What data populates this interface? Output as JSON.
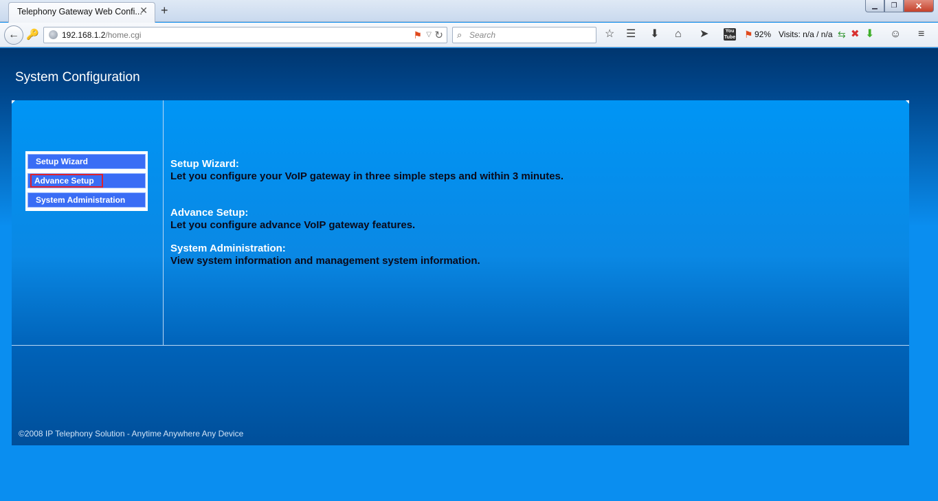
{
  "browser": {
    "tab_title": "Telephony Gateway Web Confi...",
    "tab_close": "✕",
    "new_tab": "+",
    "url_host": "192.168.1.2",
    "url_path": "/home.cgi",
    "search_placeholder": "Search",
    "battery": "92%",
    "visits": "Visits: n/a / n/a",
    "yt_label": "You Tube"
  },
  "page": {
    "title": "System Configuration",
    "menu": [
      {
        "label": "Setup Wizard"
      },
      {
        "label": "Advance Setup"
      },
      {
        "label": "System Administration"
      }
    ],
    "descriptions": [
      {
        "title": "Setup Wizard:",
        "text": "Let you configure your VoIP gateway in three simple steps and within 3 minutes."
      },
      {
        "title": "Advance Setup:",
        "text": "Let you configure advance VoIP gateway features."
      },
      {
        "title": "System Administration:",
        "text": "View system information and management system information."
      }
    ],
    "footer": "©2008 IP Telephony Solution - Anytime Anywhere Any Device"
  },
  "colors": {
    "header_dark": "#00366f",
    "panel_blue": "#0095f5",
    "menu_button": "#3a6df5",
    "active_outline": "#e0202a"
  }
}
